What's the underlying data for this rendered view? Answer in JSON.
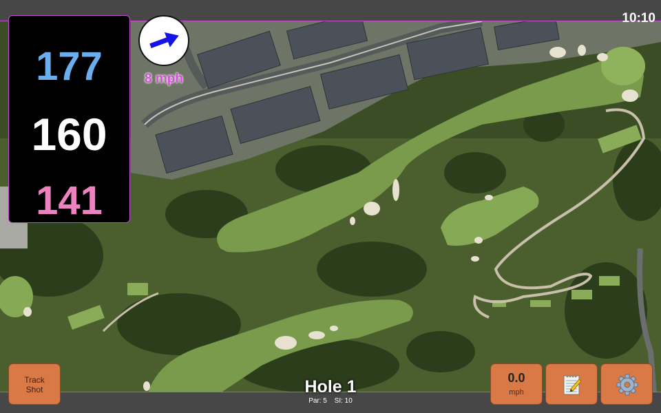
{
  "status": {
    "time": "10:10"
  },
  "distances": {
    "back": "177",
    "middle": "160",
    "front": "141"
  },
  "wind": {
    "speed": "8 mph",
    "direction_icon": "arrow-icon"
  },
  "hole": {
    "title": "Hole 1",
    "par": "Par: 5",
    "si": "SI: 10"
  },
  "buttons": {
    "track_shot_line1": "Track",
    "track_shot_line2": "Shot",
    "speed_value": "0.0",
    "speed_unit": "mph",
    "notes_icon": "notepad-icon",
    "settings_icon": "gear-icon"
  },
  "colors": {
    "back_distance": "#6aaef0",
    "middle_distance": "#ffffff",
    "front_distance": "#ee82c0",
    "accent": "#c44fd0",
    "button": "#d97946"
  }
}
